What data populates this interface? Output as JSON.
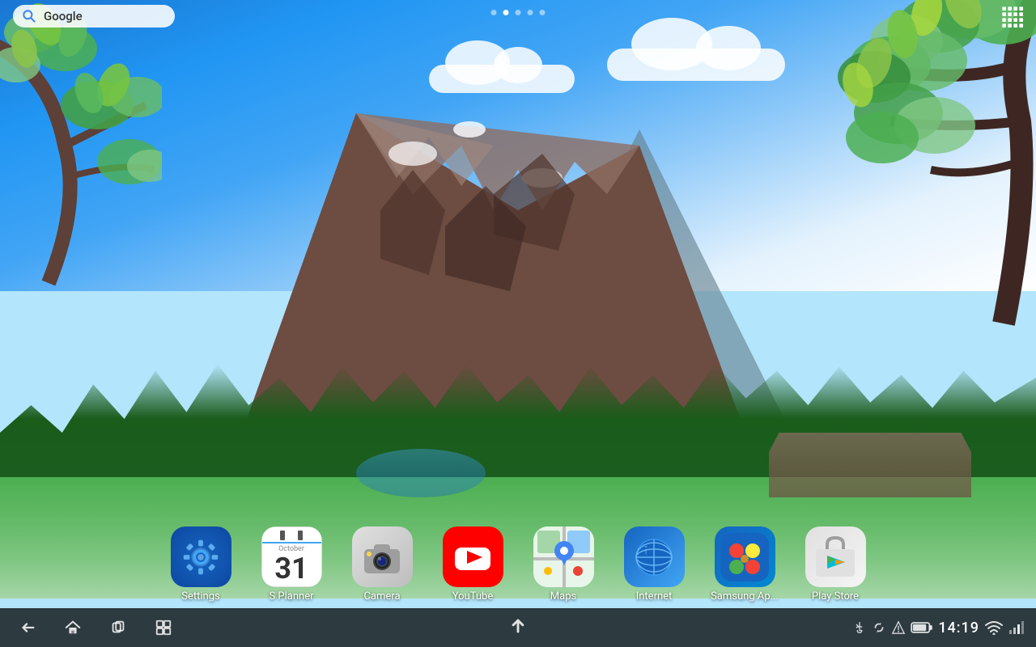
{
  "wallpaper": {
    "description": "Mountain nature wallpaper with blue sky, green meadows, and trees"
  },
  "top_bar": {
    "search_placeholder": "Google",
    "search_label": "Google"
  },
  "page_dots": [
    {
      "active": false
    },
    {
      "active": true
    },
    {
      "active": false
    },
    {
      "active": false
    },
    {
      "active": false
    }
  ],
  "apps": [
    {
      "id": "settings",
      "label": "Settings",
      "icon_type": "settings"
    },
    {
      "id": "splanner",
      "label": "S Planner",
      "icon_type": "splanner",
      "date": "31"
    },
    {
      "id": "camera",
      "label": "Camera",
      "icon_type": "camera"
    },
    {
      "id": "youtube",
      "label": "YouTube",
      "icon_type": "youtube"
    },
    {
      "id": "maps",
      "label": "Maps",
      "icon_type": "maps"
    },
    {
      "id": "internet",
      "label": "Internet",
      "icon_type": "internet"
    },
    {
      "id": "samsung",
      "label": "Samsung Ap...",
      "icon_type": "samsung"
    },
    {
      "id": "playstore",
      "label": "Play Store",
      "icon_type": "playstore"
    }
  ],
  "status_bar": {
    "time": "14:19",
    "nav": {
      "back_label": "back",
      "home_label": "home",
      "recent_label": "recent",
      "menu_label": "menu"
    }
  }
}
